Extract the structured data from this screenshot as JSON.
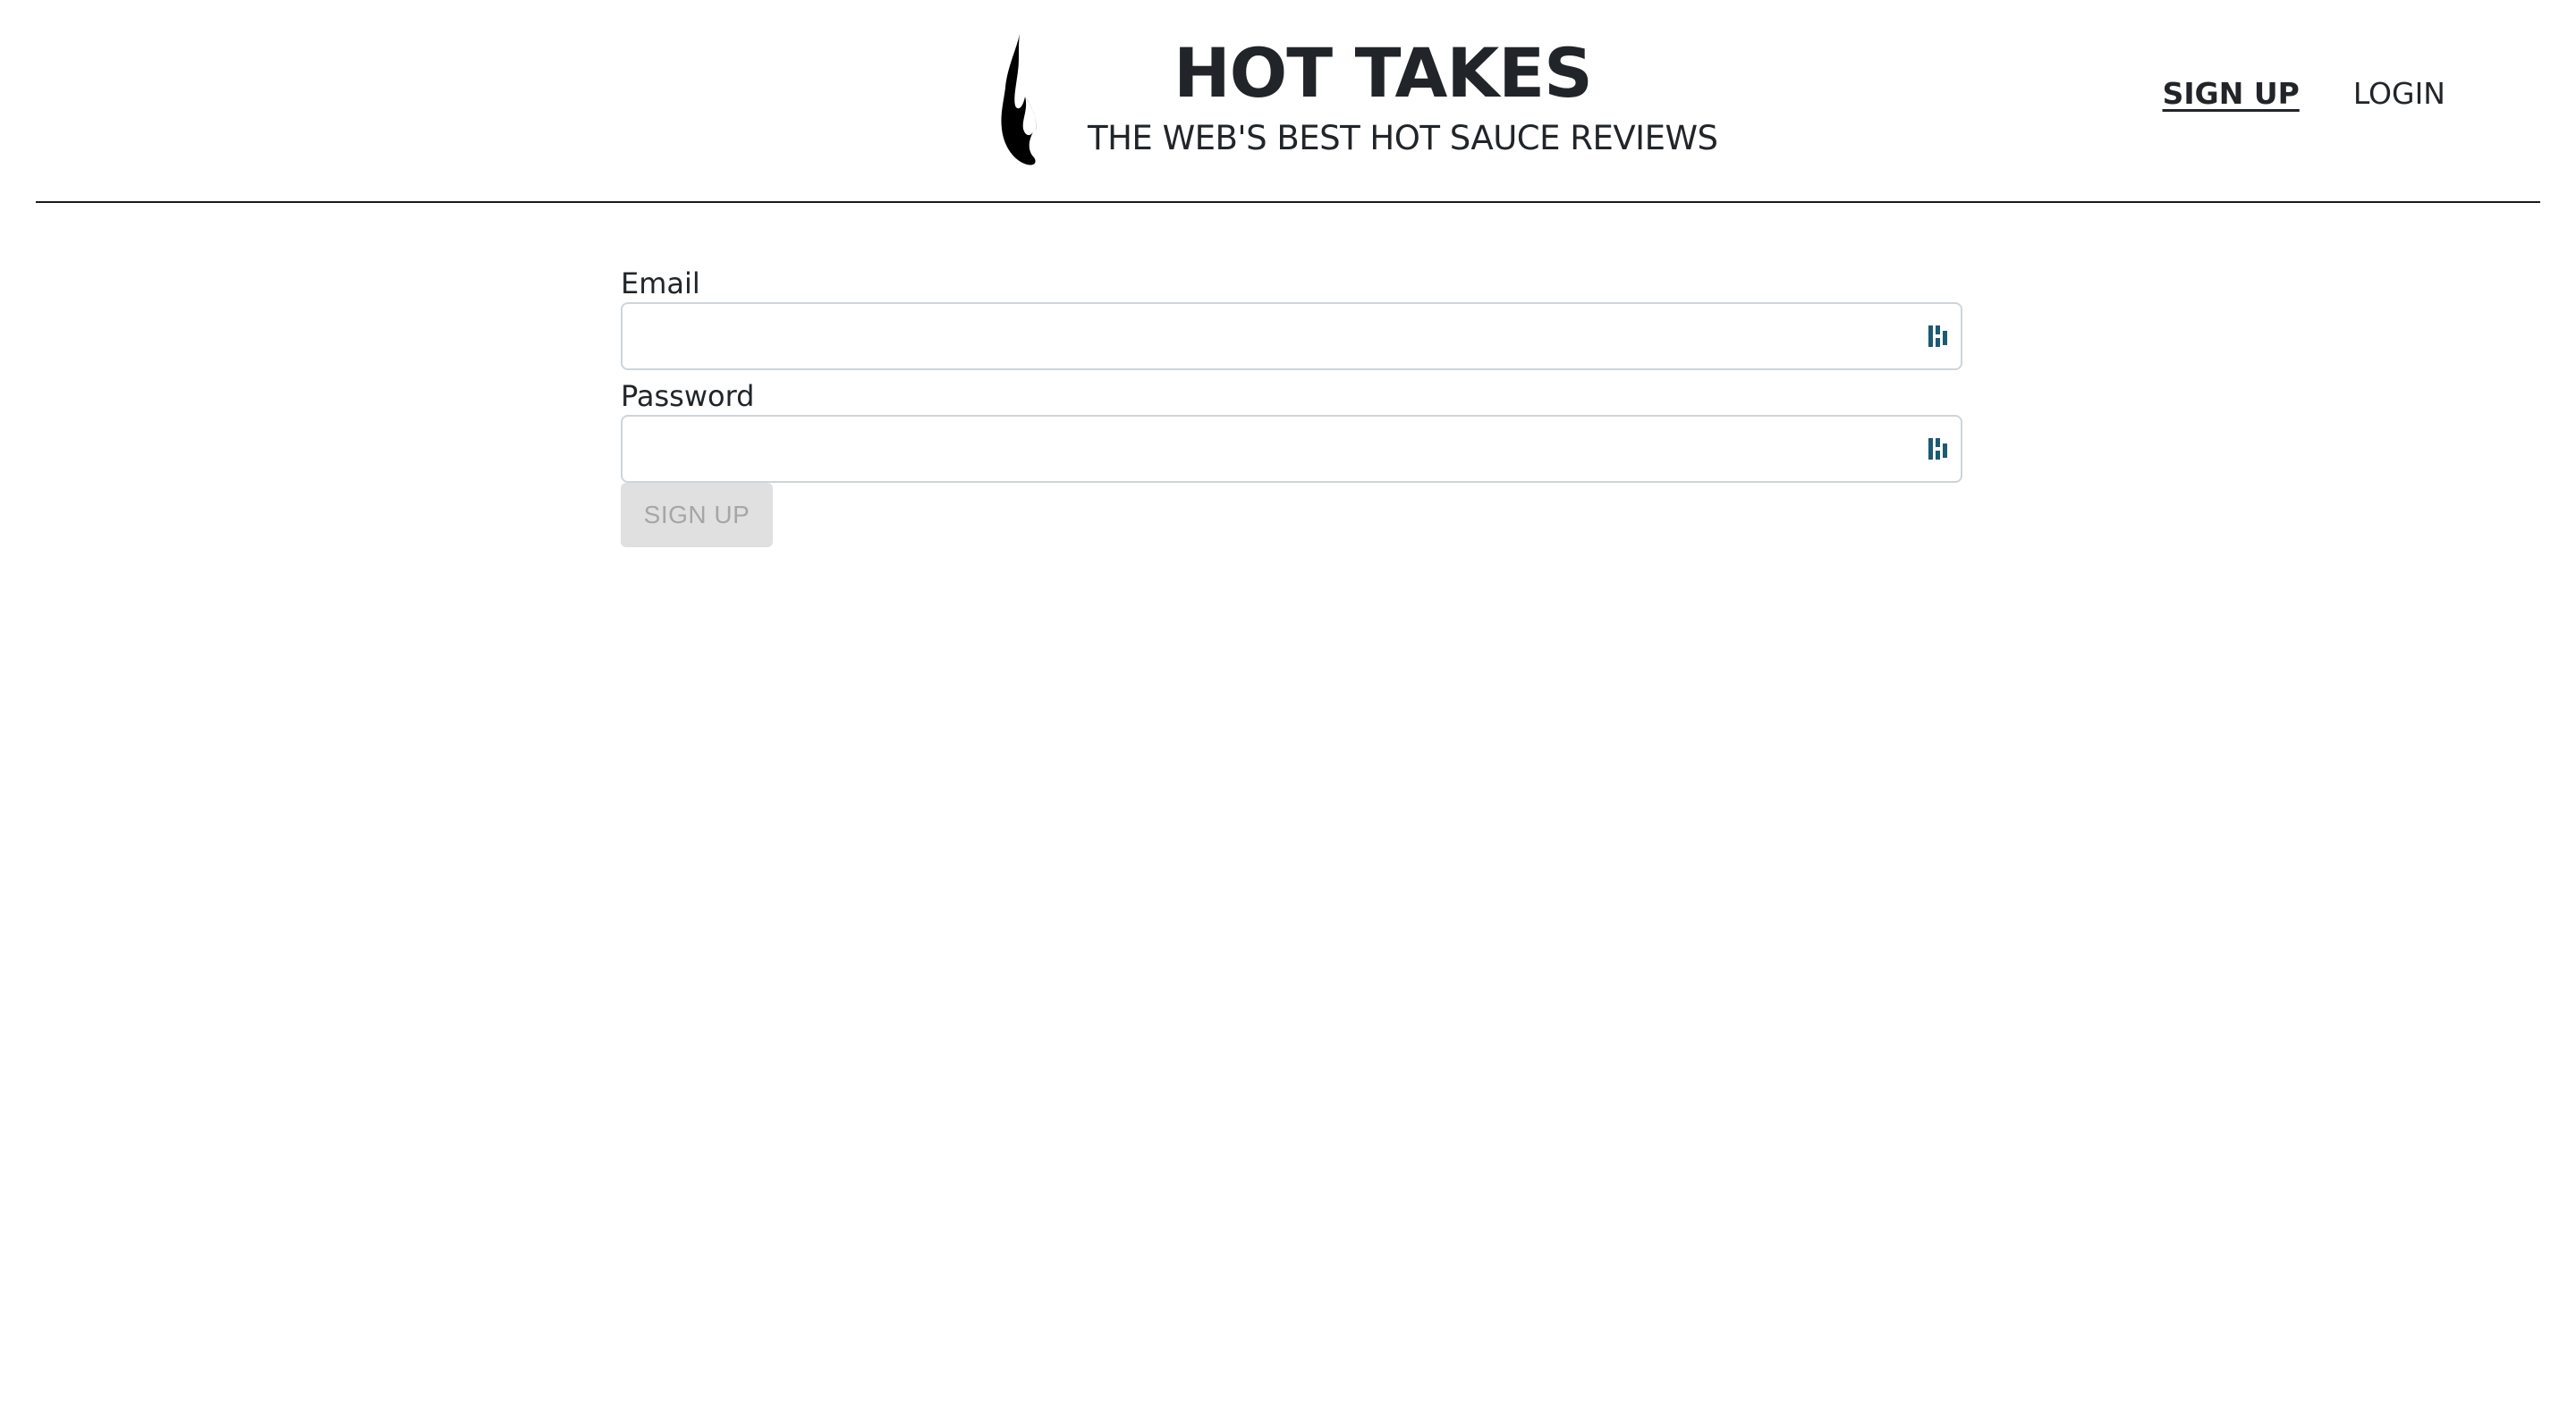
{
  "header": {
    "title": "HOT TAKES",
    "subtitle": "THE WEB'S BEST HOT SAUCE REVIEWS",
    "logo_icon": "flame-icon"
  },
  "nav": {
    "signup_label": "SIGN UP",
    "login_label": "LOGIN",
    "active": "signup"
  },
  "form": {
    "email_label": "Email",
    "email_value": "",
    "password_label": "Password",
    "password_value": "",
    "submit_label": "SIGN UP",
    "submit_disabled": true,
    "autofill_icon": "password-manager-icon"
  },
  "colors": {
    "text": "#212529",
    "divider": "#1a1a1a",
    "input_border": "#ced4da",
    "disabled_button_bg": "#e0e0e0",
    "disabled_button_text": "#a6a6a6",
    "autofill_icon": "#1c5a73"
  }
}
